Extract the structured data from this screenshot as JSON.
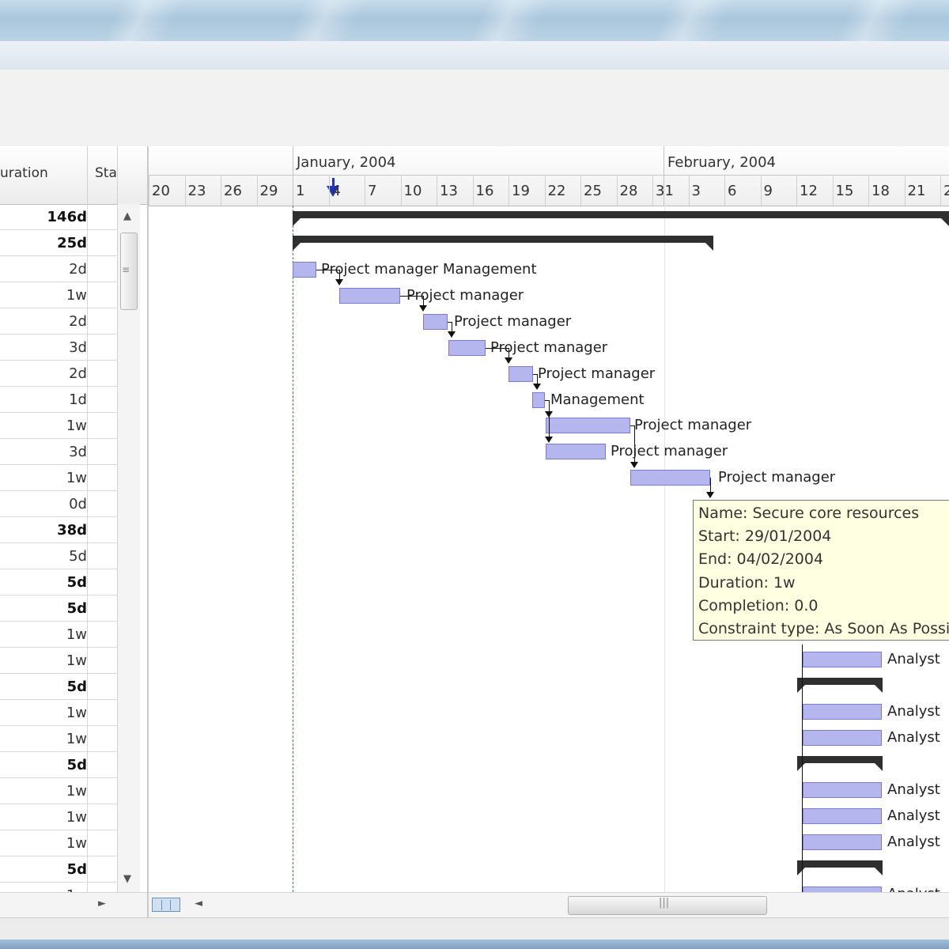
{
  "grid": {
    "col_duration": "uration",
    "col_start": "Sta",
    "durations": [
      {
        "v": "146d",
        "b": true
      },
      {
        "v": "25d",
        "b": true
      },
      {
        "v": "2d",
        "b": false
      },
      {
        "v": "1w",
        "b": false
      },
      {
        "v": "2d",
        "b": false
      },
      {
        "v": "3d",
        "b": false
      },
      {
        "v": "2d",
        "b": false
      },
      {
        "v": "1d",
        "b": false
      },
      {
        "v": "1w",
        "b": false
      },
      {
        "v": "3d",
        "b": false
      },
      {
        "v": "1w",
        "b": false
      },
      {
        "v": "0d",
        "b": false
      },
      {
        "v": "38d",
        "b": true
      },
      {
        "v": "5d",
        "b": false
      },
      {
        "v": "5d",
        "b": true
      },
      {
        "v": "5d",
        "b": true
      },
      {
        "v": "1w",
        "b": false
      },
      {
        "v": "1w",
        "b": false
      },
      {
        "v": "5d",
        "b": true
      },
      {
        "v": "1w",
        "b": false
      },
      {
        "v": "1w",
        "b": false
      },
      {
        "v": "5d",
        "b": true
      },
      {
        "v": "1w",
        "b": false
      },
      {
        "v": "1w",
        "b": false
      },
      {
        "v": "1w",
        "b": false
      },
      {
        "v": "5d",
        "b": true
      },
      {
        "v": "1w",
        "b": false
      }
    ]
  },
  "timeline": {
    "months": [
      "January, 2004",
      "February, 2004"
    ],
    "days": [
      "20",
      "23",
      "26",
      "29",
      "1",
      "4",
      "7",
      "10",
      "13",
      "16",
      "19",
      "22",
      "25",
      "28",
      "31",
      "3",
      "6",
      "9",
      "12",
      "15",
      "18",
      "21",
      "2"
    ]
  },
  "tasks": {
    "labels": [
      "Project manager Management",
      "Project manager",
      "Project manager",
      "Project manager",
      "Project manager",
      "Management",
      "Project manager",
      "Project manager",
      "Project manager",
      "Analyst",
      "Analyst",
      "Analyst",
      "Analyst",
      "Analyst",
      "Analyst",
      "Analyst"
    ]
  },
  "tooltip": {
    "name": "Name: Secure core resources",
    "start": "Start: 29/01/2004",
    "end": "End: 04/02/2004",
    "duration": "Duration: 1w",
    "completion": "Completion: 0.0",
    "constraint": "Constraint type: As Soon As Possi"
  },
  "colors": {
    "task_fill": "#b6b6ef",
    "summary_bar": "#2f2f2f",
    "tooltip_bg": "#ffffe1",
    "today_marker": "#1d35c8"
  }
}
